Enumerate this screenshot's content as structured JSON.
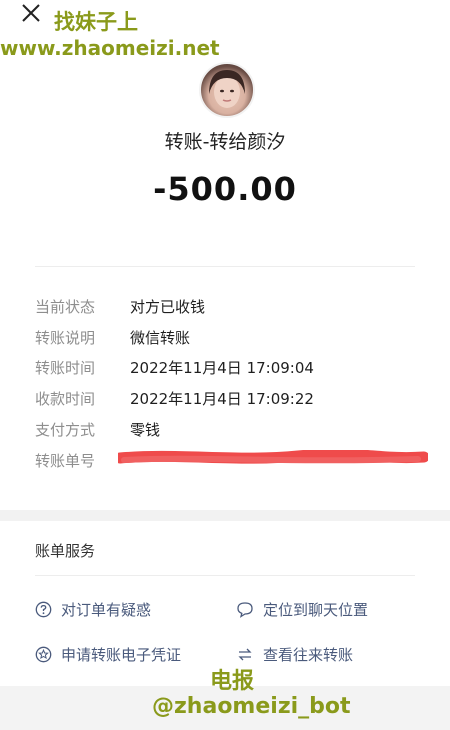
{
  "watermark": {
    "line1": "找妹子上",
    "line2": "www.zhaomeizi.net",
    "line3": "电报",
    "line4": "@zhaomeizi_bot"
  },
  "header": {
    "title": "转账-转给颜汐",
    "amount": "-500.00"
  },
  "details": [
    {
      "label": "当前状态",
      "value": "对方已收钱"
    },
    {
      "label": "转账说明",
      "value": "微信转账"
    },
    {
      "label": "转账时间",
      "value": "2022年11月4日 17:09:04"
    },
    {
      "label": "收款时间",
      "value": "2022年11月4日 17:09:22"
    },
    {
      "label": "支付方式",
      "value": "零钱"
    },
    {
      "label": "转账单号",
      "value": ""
    }
  ],
  "services": {
    "title": "账单服务",
    "items": [
      {
        "label": "对订单有疑惑",
        "icon": "question-icon"
      },
      {
        "label": "定位到聊天位置",
        "icon": "chat-bubble-icon"
      },
      {
        "label": "申请转账电子凭证",
        "icon": "certificate-icon"
      },
      {
        "label": "查看往来转账",
        "icon": "exchange-icon"
      }
    ]
  },
  "colors": {
    "watermark": "#8a9a1b",
    "link": "#4a5a7c",
    "redaction": "#ef4b4b"
  }
}
